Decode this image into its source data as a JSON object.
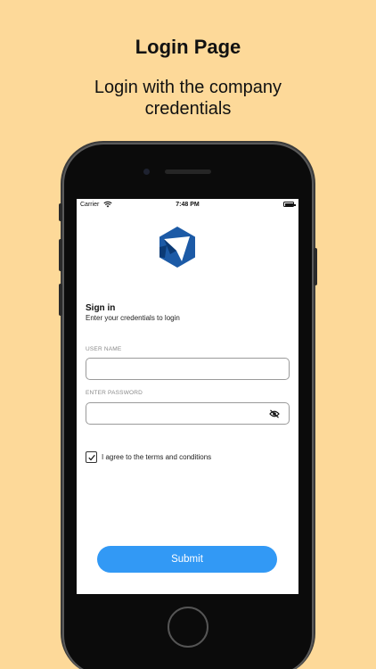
{
  "promo": {
    "title": "Login Page",
    "subtitle": "Login with the company credentials"
  },
  "status_bar": {
    "carrier": "Carrier",
    "time": "7:48 PM"
  },
  "logo": {
    "icon": "company-logo",
    "color_primary": "#1C5AA6",
    "color_accent": "#0B3A75"
  },
  "signin": {
    "title": "Sign in",
    "subtitle": "Enter your credentials to login"
  },
  "form": {
    "username_label": "USER NAME",
    "username_value": "",
    "password_label": "ENTER PASSWORD",
    "password_value": "",
    "password_toggle_icon": "eye-off-icon",
    "agree_label": "I agree to the terms and conditions",
    "agree_checked": true,
    "submit_label": "Submit"
  },
  "colors": {
    "background": "#FDD999",
    "submit": "#3299F5"
  }
}
